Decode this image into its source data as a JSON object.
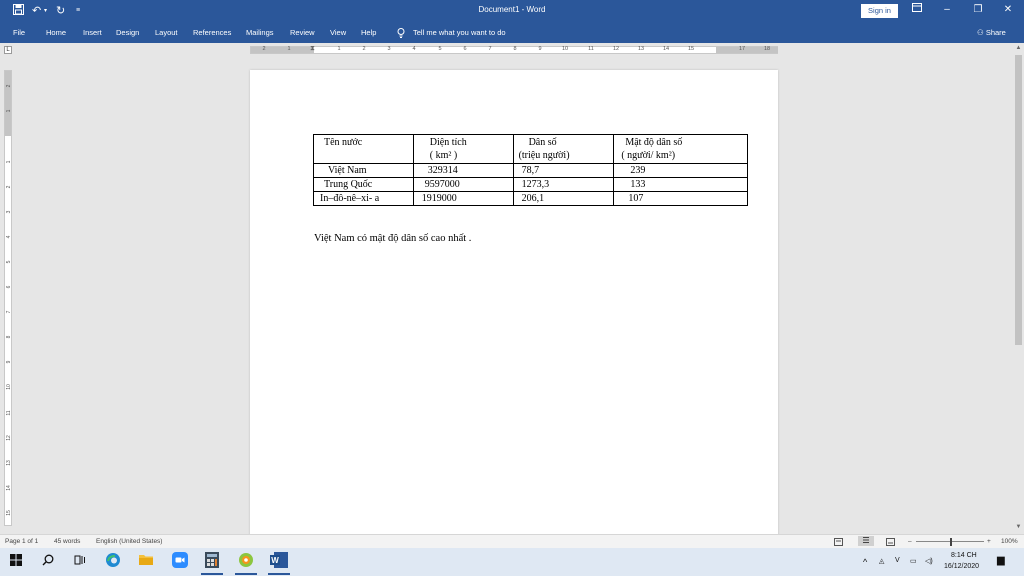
{
  "titlebar": {
    "title": "Document1  -  Word",
    "signin": "Sign in",
    "icons": [
      "save-icon",
      "undo-icon",
      "redo-icon",
      "customize-icon",
      "ribbon-display-icon",
      "minimize-icon",
      "restore-icon",
      "close-icon"
    ]
  },
  "menu": {
    "items": [
      "File",
      "Home",
      "Insert",
      "Design",
      "Layout",
      "References",
      "Mailings",
      "Review",
      "View",
      "Help"
    ],
    "tell_me": "Tell me what you want to do",
    "share": "Share"
  },
  "ruler": {
    "numbers": [
      "2",
      "1",
      "1",
      "2",
      "3",
      "4",
      "5",
      "6",
      "7",
      "8",
      "9",
      "10",
      "11",
      "12",
      "13",
      "14",
      "15",
      "17",
      "18"
    ],
    "tab_selector": "L"
  },
  "vruler": {
    "numbers": [
      "2",
      "1",
      "1",
      "2",
      "3",
      "4",
      "5",
      "6",
      "7",
      "8",
      "9",
      "10",
      "11",
      "12",
      "13",
      "14",
      "15"
    ]
  },
  "document": {
    "table": {
      "headers": [
        [
          "Tên nước",
          ""
        ],
        [
          "Diện tích",
          "( km² )"
        ],
        [
          "Dân số",
          "(triệu người)"
        ],
        [
          "Mật độ dân số",
          "( người/ km²)"
        ]
      ],
      "rows": [
        [
          "Việt Nam",
          "329314",
          "78,7",
          "239"
        ],
        [
          "Trung Quốc",
          "9597000",
          "1273,3",
          "133"
        ],
        [
          "In–đô-nê–xi- a",
          "1919000",
          "206,1",
          "107"
        ]
      ]
    },
    "paragraph": "Việt Nam có mật độ dân số cao nhất ."
  },
  "statusbar": {
    "page": "Page 1 of 1",
    "words": "45 words",
    "language": "English (United States)",
    "zoom": "100%",
    "zoom_level": 1.0
  },
  "taskbar": {
    "time": "8:14 CH",
    "date": "16/12/2020",
    "apps": [
      "windows-start-icon",
      "search-icon",
      "task-view-icon",
      "edge-icon",
      "file-explorer-icon",
      "zoom-icon",
      "calculator-icon",
      "app-icon",
      "word-icon"
    ]
  },
  "colors": {
    "accent": "#2b579a",
    "page": "#ffffff",
    "workspace": "#e6e6e6"
  }
}
